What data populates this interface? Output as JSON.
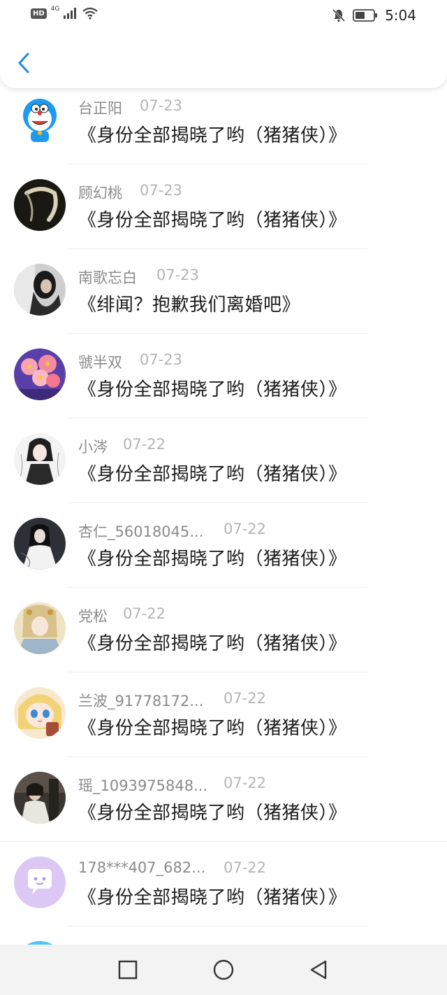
{
  "status_bar": {
    "left_badge": "HD",
    "network": "4G",
    "time": "5:04"
  },
  "header": {
    "back_icon": "chevron-left-icon",
    "accent": "#1e88e5"
  },
  "items": [
    {
      "name": "台正阳",
      "date": "07-23",
      "title": "《身份全部揭晓了哟（猪猪侠）》",
      "avatar": "doraemon"
    },
    {
      "name": "顾幻桃",
      "date": "07-23",
      "title": "《身份全部揭晓了哟（猪猪侠）》",
      "avatar": "dark-ring"
    },
    {
      "name": "南歌忘白",
      "date": "07-23",
      "title": "《绯闻？抱歉我们离婚吧》",
      "avatar": "girl-dark"
    },
    {
      "name": "虢半双",
      "date": "07-23",
      "title": "《身份全部揭晓了哟（猪猪侠）》",
      "avatar": "flowers"
    },
    {
      "name": "小涔",
      "date": "07-22",
      "title": "《身份全部揭晓了哟（猪猪侠）》",
      "avatar": "anime-sketch"
    },
    {
      "name": "杏仁_56018045...",
      "date": "07-22",
      "title": "《身份全部揭晓了哟（猪猪侠）》",
      "avatar": "anime-dark"
    },
    {
      "name": "党松",
      "date": "07-22",
      "title": "《身份全部揭晓了哟（猪猪侠）》",
      "avatar": "anime-gold"
    },
    {
      "name": "兰波_91778172...",
      "date": "07-22",
      "title": "《身份全部揭晓了哟（猪猪侠）》",
      "avatar": "anime-blonde"
    },
    {
      "name": "瑶_1093975848...",
      "date": "07-22",
      "title": "《身份全部揭晓了哟（猪猪侠）》",
      "avatar": "photo-girl"
    },
    {
      "name": "178***407_682...",
      "date": "07-22",
      "title": "《身份全部揭晓了哟（猪猪侠）》",
      "avatar": "default-chat"
    }
  ],
  "navbar": {
    "recent": "square-icon",
    "home": "circle-icon",
    "back": "triangle-back-icon"
  }
}
